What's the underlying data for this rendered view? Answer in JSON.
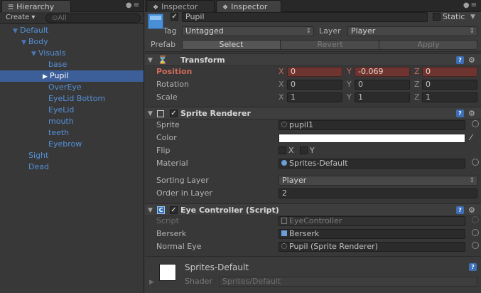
{
  "hierarchy": {
    "tab_label": "Hierarchy",
    "create_label": "Create ▾",
    "search_placeholder": "⊙All",
    "nodes": [
      {
        "label": "Default",
        "arrow": "▼"
      },
      {
        "label": "Body",
        "arrow": "▼"
      },
      {
        "label": "Visuals",
        "arrow": "▼"
      },
      {
        "label": "base",
        "arrow": ""
      },
      {
        "label": "Pupil",
        "arrow": "▶"
      },
      {
        "label": "OverEye",
        "arrow": ""
      },
      {
        "label": "EyeLid Bottom",
        "arrow": ""
      },
      {
        "label": "EyeLid",
        "arrow": ""
      },
      {
        "label": "mouth",
        "arrow": ""
      },
      {
        "label": "teeth",
        "arrow": ""
      },
      {
        "label": "Eyebrow",
        "arrow": ""
      },
      {
        "label": "Sight",
        "arrow": ""
      },
      {
        "label": "Dead",
        "arrow": ""
      }
    ]
  },
  "inspector": {
    "tabs": [
      "Inspector",
      "Inspector"
    ],
    "object_name": "Pupil",
    "static_label": "Static",
    "tag_label": "Tag",
    "tag_value": "Untagged",
    "layer_label": "Layer",
    "layer_value": "Player",
    "prefab_label": "Prefab",
    "prefab_select": "Select",
    "prefab_revert": "Revert",
    "prefab_apply": "Apply",
    "transform": {
      "title": "Transform",
      "position_label": "Position",
      "rotation_label": "Rotation",
      "scale_label": "Scale",
      "position": {
        "x": "0",
        "y": "-0.069",
        "z": "0"
      },
      "rotation": {
        "x": "0",
        "y": "0",
        "z": "0"
      },
      "scale": {
        "x": "1",
        "y": "1",
        "z": "1"
      }
    },
    "axis_labels": {
      "x": "X",
      "y": "Y",
      "z": "Z"
    },
    "sprite_renderer": {
      "title": "Sprite Renderer",
      "sprite_label": "Sprite",
      "sprite_value": "pupil1",
      "color_label": "Color",
      "flip_label": "Flip",
      "flip_x": "X",
      "flip_y": "Y",
      "material_label": "Material",
      "material_value": "Sprites-Default",
      "sorting_layer_label": "Sorting Layer",
      "sorting_layer_value": "Player",
      "order_label": "Order in Layer",
      "order_value": "2"
    },
    "eye_controller": {
      "title": "Eye Controller (Script)",
      "script_label": "Script",
      "script_value": "EyeController",
      "berserk_label": "Berserk",
      "berserk_value": "Berserk",
      "normal_eye_label": "Normal Eye",
      "normal_eye_value": "Pupil (Sprite Renderer)"
    },
    "material_preview": {
      "name": "Sprites-Default",
      "shader_label": "Shader",
      "shader_value": "Sprites/Default"
    }
  },
  "colors": {
    "accent_selected": "#3c5f99",
    "hierarchy_text": "#5590d8",
    "position_highlight": "#6e3530",
    "position_label": "#d06a5a"
  }
}
